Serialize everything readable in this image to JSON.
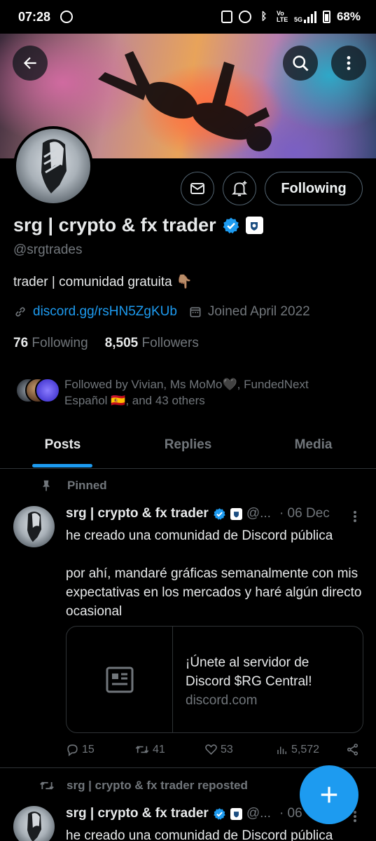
{
  "status_bar": {
    "time": "07:28",
    "network": "5G",
    "volte": "Vo LTE",
    "battery": "68%"
  },
  "header": {
    "back_icon": "back-arrow-icon",
    "search_icon": "search-icon",
    "more_icon": "more-vertical-icon"
  },
  "profile": {
    "display_name": "srg | crypto & fx trader",
    "handle": "@srgtrades",
    "bio": "trader | comunidad gratuita 👇🏽",
    "link": "discord.gg/rsHN5ZgKUb",
    "joined": "Joined April 2022",
    "following_count": "76",
    "following_label": "Following",
    "followers_count": "8,505",
    "followers_label": "Followers",
    "follow_button": "Following",
    "followed_by_text": "Followed by Vivian, Ms MoMo🖤, FundedNext Español 🇪🇸, and 43 others"
  },
  "tabs": [
    {
      "label": "Posts",
      "active": true
    },
    {
      "label": "Replies",
      "active": false
    },
    {
      "label": "Media",
      "active": false
    }
  ],
  "pinned_tweet": {
    "pinned_label": "Pinned",
    "name": "srg | crypto & fx trader",
    "handle": "@...",
    "date": "· 06 Dec",
    "text_line1": "he creado una comunidad de Discord pública",
    "text_para2": "por ahí, mandaré gráficas semanalmente con mis expectativas en los mercados y haré algún directo ocasional",
    "card_title": "¡Únete al servidor de Discord $RG Central!",
    "card_domain": "discord.com",
    "replies": "15",
    "reposts": "41",
    "likes": "53",
    "views": "5,572"
  },
  "second_tweet": {
    "repost_label": "srg | crypto & fx trader reposted",
    "name": "srg | crypto & fx trader",
    "handle": "@...",
    "date": "· 06",
    "text_line1": "he creado una comunidad de Discord pública"
  },
  "colors": {
    "accent": "#1d9bf0",
    "background": "#000000",
    "secondary_text": "#71767b",
    "border": "#2f3336"
  }
}
